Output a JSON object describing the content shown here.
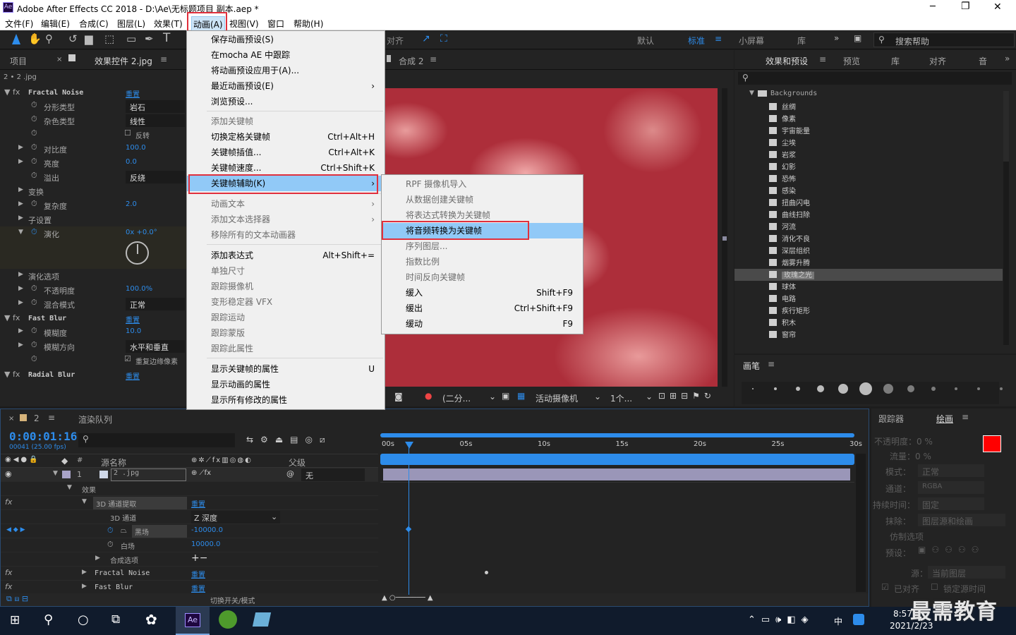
{
  "window": {
    "title": "Adobe After Effects CC 2018 - D:\\Ae\\无标题项目 副本.aep *",
    "min": "─",
    "max": "❐",
    "close": "✕"
  },
  "menubar": [
    "文件(F)",
    "编辑(E)",
    "合成(C)",
    "图层(L)",
    "效果(T)",
    "动画(A)",
    "视图(V)",
    "窗口",
    "帮助(H)"
  ],
  "toolbar": {
    "workspaces": [
      "默认",
      "标准",
      "小屏幕",
      "库"
    ],
    "search": "搜索帮助",
    "align": "对齐"
  },
  "left_panel": {
    "tab_project": "项目",
    "tab_effects": "效果控件 2.jpg",
    "layer": "2 • 2 .jpg",
    "rows": [
      {
        "name": "Fractal Noise",
        "val": "重置"
      },
      {
        "name": "分形类型",
        "val": "岩石"
      },
      {
        "name": "杂色类型",
        "val": "线性"
      },
      {
        "name": "",
        "val": "反转"
      },
      {
        "name": "对比度",
        "val": "100.0"
      },
      {
        "name": "亮度",
        "val": "0.0"
      },
      {
        "name": "溢出",
        "val": "反绕"
      },
      {
        "name": "变换",
        "val": ""
      },
      {
        "name": "复杂度",
        "val": "2.0"
      },
      {
        "name": "子设置",
        "val": ""
      },
      {
        "name": "演化",
        "val": "0x +0.0°"
      },
      {
        "name": "演化选项",
        "val": ""
      },
      {
        "name": "不透明度",
        "val": "100.0%"
      },
      {
        "name": "混合模式",
        "val": "正常"
      },
      {
        "name": "Fast Blur",
        "val": "重置"
      },
      {
        "name": "模糊度",
        "val": "10.0"
      },
      {
        "name": "模糊方向",
        "val": "水平和垂直"
      },
      {
        "name": "",
        "val": "重复边缘像素"
      },
      {
        "name": "Radial Blur",
        "val": "重置"
      }
    ]
  },
  "comp": {
    "tab": "合成 2",
    "view": "(二分...",
    "camera": "活动摄像机",
    "views": "1个..."
  },
  "animation_menu": {
    "items": [
      {
        "label": "保存动画预设(S)",
        "sc": "",
        "dis": false
      },
      {
        "label": "在mocha AE 中跟踪",
        "sc": "",
        "dis": false
      },
      {
        "label": "将动画预设应用于(A)...",
        "sc": "",
        "dis": false
      },
      {
        "label": "最近动画预设(E)",
        "sc": "›",
        "dis": false
      },
      {
        "label": "浏览预设...",
        "sc": "",
        "dis": false
      },
      {
        "label": "添加关键帧",
        "sc": "",
        "dis": true
      },
      {
        "label": "切换定格关键帧",
        "sc": "Ctrl+Alt+H",
        "dis": false
      },
      {
        "label": "关键帧插值...",
        "sc": "Ctrl+Alt+K",
        "dis": false
      },
      {
        "label": "关键帧速度...",
        "sc": "Ctrl+Shift+K",
        "dis": false
      },
      {
        "label": "关键帧辅助(K)",
        "sc": "›",
        "dis": false
      },
      {
        "label": "动画文本",
        "sc": "›",
        "dis": true
      },
      {
        "label": "添加文本选择器",
        "sc": "›",
        "dis": true
      },
      {
        "label": "移除所有的文本动画器",
        "sc": "",
        "dis": true
      },
      {
        "label": "添加表达式",
        "sc": "Alt+Shift+=",
        "dis": false
      },
      {
        "label": "单独尺寸",
        "sc": "",
        "dis": true
      },
      {
        "label": "跟踪摄像机",
        "sc": "",
        "dis": true
      },
      {
        "label": "变形稳定器 VFX",
        "sc": "",
        "dis": true
      },
      {
        "label": "跟踪运动",
        "sc": "",
        "dis": true
      },
      {
        "label": "跟踪蒙版",
        "sc": "",
        "dis": true
      },
      {
        "label": "跟踪此属性",
        "sc": "",
        "dis": true
      },
      {
        "label": "显示关键帧的属性",
        "sc": "U",
        "dis": false
      },
      {
        "label": "显示动画的属性",
        "sc": "",
        "dis": false
      },
      {
        "label": "显示所有修改的属性",
        "sc": "",
        "dis": false
      }
    ]
  },
  "keyframe_submenu": {
    "items": [
      {
        "label": "RPF 摄像机导入",
        "sc": "",
        "dis": true
      },
      {
        "label": "从数据创建关键帧",
        "sc": "",
        "dis": true
      },
      {
        "label": "将表达式转换为关键帧",
        "sc": "",
        "dis": true
      },
      {
        "label": "将音频转换为关键帧",
        "sc": "",
        "dis": false
      },
      {
        "label": "序列图层...",
        "sc": "",
        "dis": true
      },
      {
        "label": "指数比例",
        "sc": "",
        "dis": true
      },
      {
        "label": "时间反向关键帧",
        "sc": "",
        "dis": true
      },
      {
        "label": "缓入",
        "sc": "Shift+F9",
        "dis": false
      },
      {
        "label": "缓出",
        "sc": "Ctrl+Shift+F9",
        "dis": false
      },
      {
        "label": "缓动",
        "sc": "F9",
        "dis": false
      }
    ]
  },
  "right_panel": {
    "tabs": [
      "效果和预设",
      "预览",
      "库",
      "对齐",
      "音"
    ],
    "folder": "Backgrounds",
    "items": [
      "丝绸",
      "像素",
      "宇宙能量",
      "尘埃",
      "岩浆",
      "幻影",
      "恐怖",
      "感染",
      "扭曲闪电",
      "曲线扫除",
      "河流",
      "消化不良",
      "深层组织",
      "烟雾升腾",
      "玫瑰之光",
      "球体",
      "电路",
      "疾行矩形",
      "积木",
      "窗帘"
    ],
    "selected": "玫瑰之光",
    "brush_tab": "画笔"
  },
  "timeline": {
    "tab": "2",
    "render": "渲染队列",
    "time": "0:00:01:16",
    "fps": "00041 (25.00 fps)",
    "col_source": "源名称",
    "col_parent": "父级",
    "layer_num": "1",
    "layer_name": "2 .jpg",
    "parent": "无",
    "effects": "效果",
    "fx1": "3D 通道提取",
    "reset": "重置",
    "ch": "3D 通道",
    "ch_val": "Z 深度",
    "black": "黑场",
    "black_val": "-10000.0",
    "white": "白场",
    "white_val": "10000.0",
    "composite": "合成选项",
    "fx2": "Fractal Noise",
    "fx3": "Fast Blur",
    "toggle": "切换开关/模式",
    "ruler": [
      "00s",
      "05s",
      "10s",
      "15s",
      "20s",
      "25s",
      "30s"
    ]
  },
  "paint": {
    "tab1": "跟踪器",
    "tab2": "绘画",
    "opacity": "不透明度：0 %",
    "flow": "流量：0 %",
    "mode": "模式：",
    "mode_val": "正常",
    "channel": "通道：",
    "channel_val": "RGBA",
    "duration": "持续时间：",
    "duration_val": "固定",
    "erase": "抹除：",
    "erase_val": "图层源和绘画",
    "clone": "仿制选项",
    "preset": "预设：",
    "source": "源：",
    "source_val": "当前图层",
    "aligned": "已对齐",
    "lock": "锁定源时间"
  },
  "taskbar": {
    "time": "8:57",
    "date": "2021/2/23",
    "ime": "中",
    "ae": "Ae"
  },
  "watermark": "最需教育"
}
